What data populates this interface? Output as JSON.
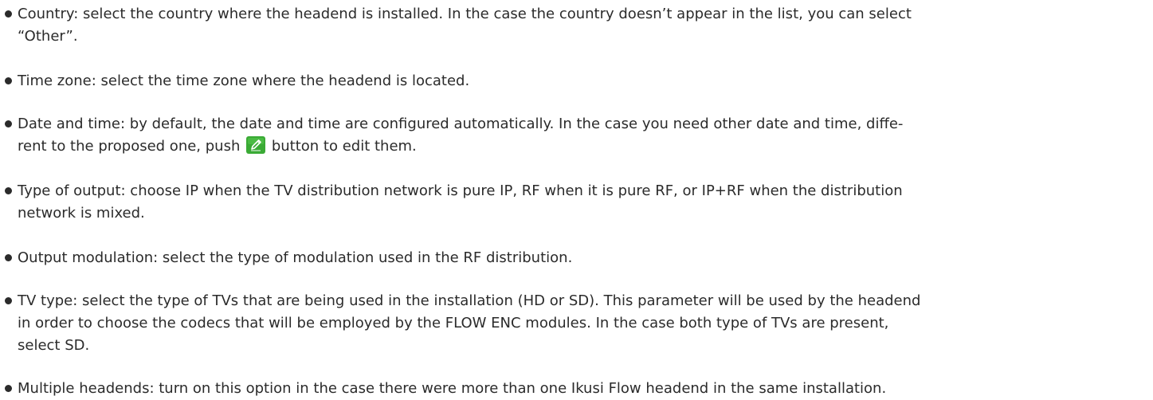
{
  "bullets": [
    {
      "text": "Country: select the country where the headend is installed. In the case the country doesn’t appear in the list, you can select\n“Other”."
    },
    {
      "text": "Time zone: select the time zone where the headend is located."
    },
    {
      "text_before": "Date and time: by default, the date and time are configured automatically. In the case you need other date and time, diffe-\nrent to the proposed one, push ",
      "text_after": " button to edit them.",
      "icon": "edit-pencil-icon",
      "icon_color": "#3aaa35"
    },
    {
      "text": "Type of output: choose IP when the TV distribution network is pure IP, RF when it is pure RF, or IP+RF when the distribution\nnetwork is mixed."
    },
    {
      "text": "Output modulation: select the type of modulation used in the RF distribution."
    },
    {
      "text": "TV type: select the type of TVs that are being used in the installation (HD or SD). This parameter will be used by the headend\nin order to choose the codecs that will be employed by the FLOW ENC modules. In the case both type of TVs are present,\nselect SD."
    },
    {
      "text": "Multiple headends: turn on this option in the case there were more than one Ikusi Flow headend in the same installation."
    }
  ]
}
